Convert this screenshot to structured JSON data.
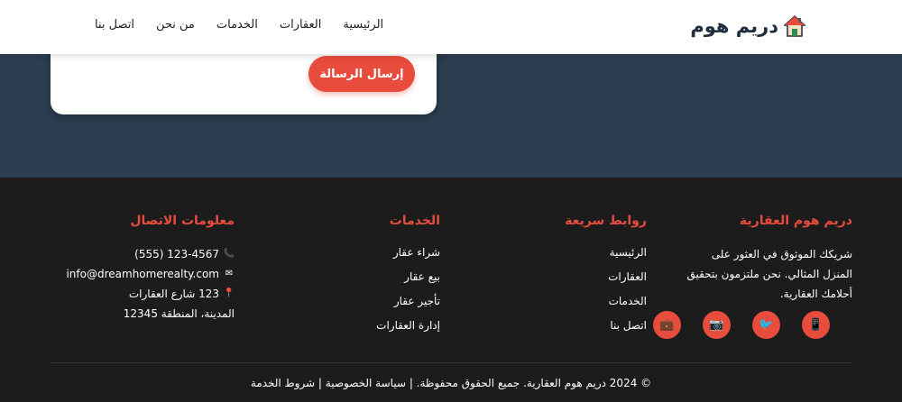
{
  "header": {
    "brand": "دريم هوم",
    "nav": [
      "الرئيسية",
      "العقارات",
      "الخدمات",
      "من نحن",
      "اتصل بنا"
    ]
  },
  "form": {
    "submit_label": "إرسال الرسالة"
  },
  "footer": {
    "brand": {
      "title": "دريم هوم العقارية",
      "description": "شريكك الموثوق في العثور على المنزل المثالي. نحن ملتزمون بتحقيق أحلامك العقارية."
    },
    "quick_links": {
      "title": "روابط سريعة",
      "items": [
        "الرئيسية",
        "العقارات",
        "الخدمات",
        "اتصل بنا"
      ]
    },
    "services": {
      "title": "الخدمات",
      "items": [
        "شراء عقار",
        "بيع عقار",
        "تأجير عقار",
        "إدارة العقارات"
      ]
    },
    "contact": {
      "title": "معلومات الاتصال",
      "phone": "(555) 123-4567",
      "email": "info@dreamhomerealty.com",
      "address_line1": "123 شارع العقارات",
      "address_line2": "المدينة، المنطقة 12345"
    },
    "socials": [
      {
        "name": "tablet-icon",
        "glyph": "📱"
      },
      {
        "name": "bird-icon",
        "glyph": "🐦"
      },
      {
        "name": "camera-icon",
        "glyph": "📷"
      },
      {
        "name": "briefcase-icon",
        "glyph": "💼"
      }
    ],
    "copyright": "© 2024 دريم هوم العقارية. جميع الحقوق محفوظة. | سياسة الخصوصية | شروط الخدمة"
  },
  "colors": {
    "accent": "#e74c3c",
    "dark_band": "#2c3e50",
    "footer_bg": "#1c1c1c"
  }
}
